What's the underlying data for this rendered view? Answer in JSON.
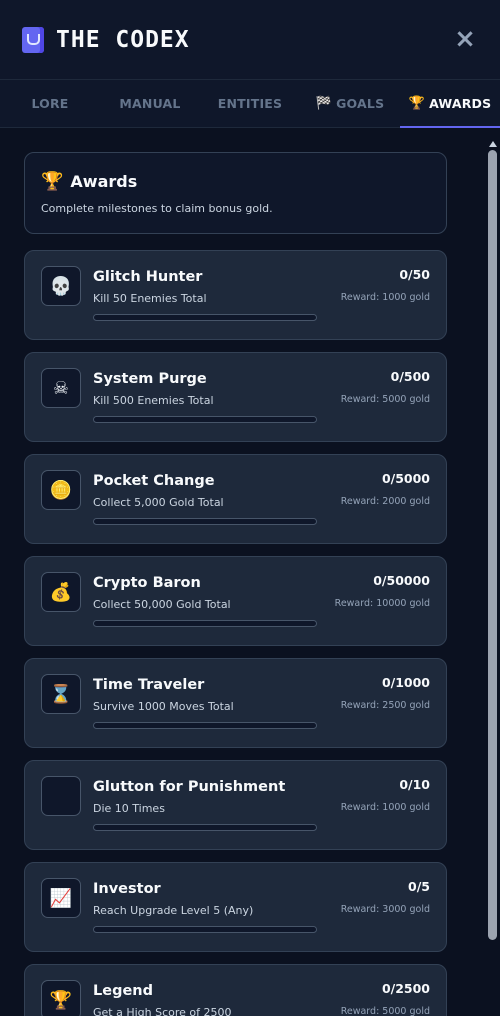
{
  "app": {
    "title": "THE CODEX",
    "close_icon": "×"
  },
  "tabs": [
    {
      "label": "LORE",
      "icon": "",
      "active": false
    },
    {
      "label": "MANUAL",
      "icon": "",
      "active": false
    },
    {
      "label": "ENTITIES",
      "icon": "",
      "active": false
    },
    {
      "label": "GOALS",
      "icon": "🏁",
      "active": false
    },
    {
      "label": "AWARDS",
      "icon": "🏆",
      "active": true
    }
  ],
  "intro": {
    "icon": "🏆",
    "title": "Awards",
    "subtitle": "Complete milestones to claim bonus gold."
  },
  "awards": [
    {
      "icon": "💀",
      "icon_name": "skull-icon",
      "name": "Glitch Hunter",
      "desc": "Kill 50 Enemies Total",
      "progress": "0/50",
      "reward": "Reward: 1000 gold",
      "fill": 0
    },
    {
      "icon": "☠",
      "icon_name": "skull-crossbones-icon",
      "name": "System Purge",
      "desc": "Kill 500 Enemies Total",
      "progress": "0/500",
      "reward": "Reward: 5000 gold",
      "fill": 0
    },
    {
      "icon": "🪙",
      "icon_name": "coin-stack-icon",
      "name": "Pocket Change",
      "desc": "Collect 5,000 Gold Total",
      "progress": "0/5000",
      "reward": "Reward: 2000 gold",
      "fill": 0
    },
    {
      "icon": "💰",
      "icon_name": "money-bag-icon",
      "name": "Crypto Baron",
      "desc": "Collect 50,000 Gold Total",
      "progress": "0/50000",
      "reward": "Reward: 10000 gold",
      "fill": 0
    },
    {
      "icon": "⌛",
      "icon_name": "hourglass-icon",
      "name": "Time Traveler",
      "desc": "Survive 1000 Moves Total",
      "progress": "0/1000",
      "reward": "Reward: 2500 gold",
      "fill": 0
    },
    {
      "icon": "",
      "icon_name": "blank-icon",
      "name": "Glutton for Punishment",
      "desc": "Die 10 Times",
      "progress": "0/10",
      "reward": "Reward: 1000 gold",
      "fill": 0
    },
    {
      "icon": "📈",
      "icon_name": "chart-up-icon",
      "name": "Investor",
      "desc": "Reach Upgrade Level 5 (Any)",
      "progress": "0/5",
      "reward": "Reward: 3000 gold",
      "fill": 0
    },
    {
      "icon": "🏆",
      "icon_name": "trophy-icon",
      "name": "Legend",
      "desc": "Get a High Score of 2500",
      "progress": "0/2500",
      "reward": "Reward: 5000 gold",
      "fill": 0
    }
  ]
}
